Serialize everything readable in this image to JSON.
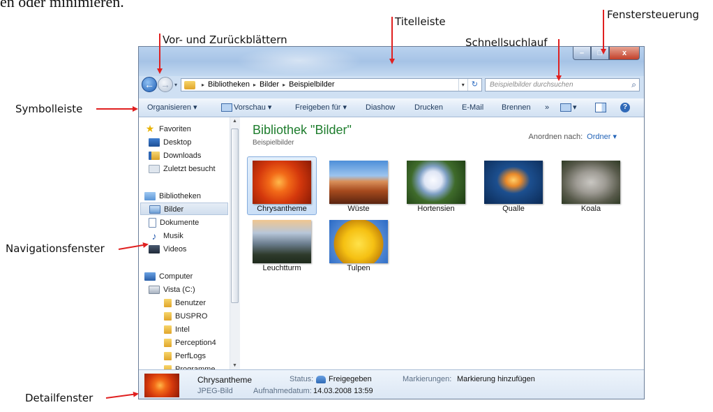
{
  "document": {
    "top_text": "en oder minimieren."
  },
  "annotations": {
    "vor_zurueck": "Vor- und Zurückblättern",
    "titelleiste": "Titelleiste",
    "fenstersteuerung": "Fenstersteuerung",
    "schnellsuchlauf": "Schnellsuchlauf",
    "symbolleiste": "Symbolleiste",
    "navigationsfenster": "Navigationsfenster",
    "detailfenster": "Detailfenster"
  },
  "window": {
    "controls": {
      "minimize": "–",
      "maximize": "□",
      "close": "x"
    },
    "nav": {
      "back": "←",
      "forward": "→",
      "recent": "▾"
    },
    "address": {
      "crumbs": [
        "Bibliotheken",
        "Bilder",
        "Beispielbilder"
      ],
      "separator": "▸",
      "dropdown": "▾",
      "refresh": "↻"
    },
    "search": {
      "placeholder": "Beispielbilder durchsuchen",
      "icon": "⌕"
    },
    "toolbar": {
      "organize": "Organisieren ▾",
      "preview": "Vorschau ▾",
      "share": "Freigeben für ▾",
      "slideshow": "Diashow",
      "print": "Drucken",
      "email": "E-Mail",
      "burn": "Brennen",
      "more": "»",
      "views": "▾",
      "help": "?"
    },
    "navpane": {
      "favorites": "Favoriten",
      "desktop": "Desktop",
      "downloads": "Downloads",
      "recent": "Zuletzt besucht",
      "libraries": "Bibliotheken",
      "pictures": "Bilder",
      "documents": "Dokumente",
      "music": "Musik",
      "videos": "Videos",
      "computer": "Computer",
      "drive": "Vista (C:)",
      "folders": [
        "Benutzer",
        "BUSPRO",
        "Intel",
        "Perception4",
        "PerfLogs",
        "Programme"
      ],
      "scroll_up": "▲",
      "scroll_down": "▼"
    },
    "content": {
      "title": "Bibliothek \"Bilder\"",
      "subtitle": "Beispielbilder",
      "arrange_label": "Anordnen nach:",
      "arrange_value": "Ordner ▾",
      "items": [
        "Chrysantheme",
        "Wüste",
        "Hortensien",
        "Qualle",
        "Koala",
        "Leuchtturm",
        "Tulpen"
      ],
      "selected_index": 0
    },
    "details": {
      "name": "Chrysantheme",
      "type": "JPEG-Bild",
      "status_label": "Status:",
      "status_value": "Freigegeben",
      "date_label": "Aufnahmedatum:",
      "date_value": "14.03.2008 13:59",
      "tags_label": "Markierungen:",
      "tags_value": "Markierung hinzufügen"
    }
  },
  "colors": {
    "arrow": "#e02020",
    "library_title": "#1e7d2d",
    "link": "#2364b8"
  }
}
